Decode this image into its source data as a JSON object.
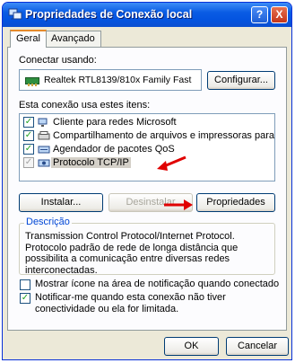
{
  "window": {
    "title": "Propriedades de Conexão local",
    "help_label": "?",
    "close_label": "X"
  },
  "tabs": [
    {
      "label": "Geral"
    },
    {
      "label": "Avançado"
    }
  ],
  "connect_using": {
    "label": "Conectar usando:",
    "adapter": "Realtek RTL8139/810x Family Fast",
    "configure_label": "Configurar..."
  },
  "items_section": {
    "label": "Esta conexão usa estes itens:",
    "items": [
      {
        "label": "Cliente para redes Microsoft",
        "checked": true
      },
      {
        "label": "Compartilhamento de arquivos e impressoras para redes...",
        "checked": true
      },
      {
        "label": "Agendador de pacotes QoS",
        "checked": true
      },
      {
        "label": "Protocolo TCP/IP",
        "checked": true
      }
    ]
  },
  "actions": {
    "install": "Instalar...",
    "uninstall": "Desinstalar",
    "properties": "Propriedades"
  },
  "description": {
    "title": "Descrição",
    "text": "Transmission Control Protocol/Internet Protocol. Protocolo padrão de rede de longa distância que possibilita a comunicação entre diversas redes interconectadas."
  },
  "options": [
    {
      "label": "Mostrar ícone na área de notificação quando conectado",
      "checked": false
    },
    {
      "label": "Notificar-me quando esta conexão não tiver conectividade ou ela for limitada.",
      "checked": true
    }
  ],
  "footer": {
    "ok": "OK",
    "cancel": "Cancelar"
  },
  "colors": {
    "titlebar": "#0454e0",
    "annotation_arrow": "#e00000",
    "group_title": "#0046d5"
  }
}
